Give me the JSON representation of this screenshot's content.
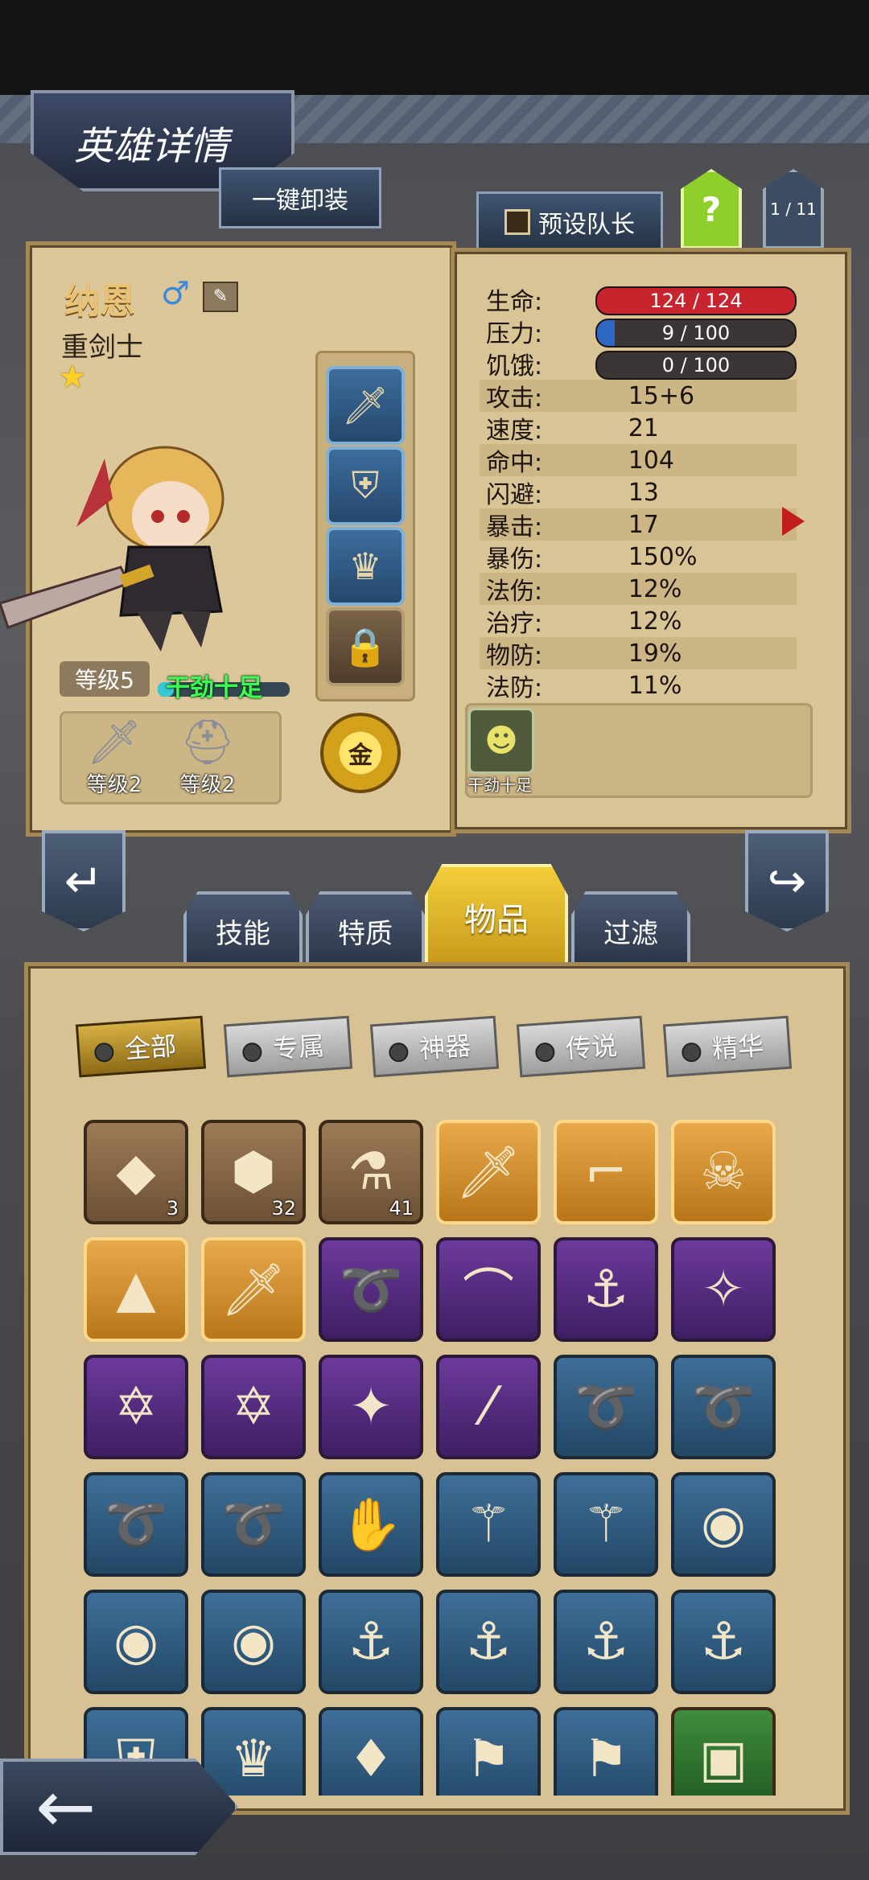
{
  "header": {
    "title": "英雄详情"
  },
  "top_buttons": {
    "unequip_all": "一键卸装",
    "preset_leader": "预设队长",
    "help": "?",
    "page": "1 / 11"
  },
  "hero": {
    "name": "纳恩",
    "class": "重剑士",
    "level": "等级5",
    "status": "干劲十足",
    "equipment_slots": [
      "sword-icon",
      "shield-icon",
      "helmet-icon",
      "lock-icon"
    ],
    "gear": [
      {
        "icon": "sword-icon",
        "label": "等级2"
      },
      {
        "icon": "helmet-icon",
        "label": "等级2"
      }
    ],
    "gold_label": "金"
  },
  "stats": {
    "hp": {
      "label": "生命:",
      "value": "124 / 124",
      "fraction": 1.0,
      "color": "#c8242e"
    },
    "stress": {
      "label": "压力:",
      "value": "9 / 100",
      "fraction": 0.09,
      "color": "#2f67c4"
    },
    "hunger": {
      "label": "饥饿:",
      "value": "0 / 100",
      "fraction": 0.0,
      "color": "#d89a2a"
    },
    "rows": [
      {
        "label": "攻击:",
        "value": "15+6"
      },
      {
        "label": "速度:",
        "value": "21"
      },
      {
        "label": "命中:",
        "value": "104"
      },
      {
        "label": "闪避:",
        "value": "13"
      },
      {
        "label": "暴击:",
        "value": "17"
      },
      {
        "label": "暴伤:",
        "value": "150%"
      },
      {
        "label": "法伤:",
        "value": "12%"
      },
      {
        "label": "治疗:",
        "value": "12%"
      },
      {
        "label": "物防:",
        "value": "19%"
      },
      {
        "label": "法防:",
        "value": "11%"
      }
    ]
  },
  "trait": {
    "label": "干劲十足"
  },
  "tabs": {
    "skills": "技能",
    "traits": "特质",
    "items": "物品",
    "filter": "过滤"
  },
  "filters": {
    "all": "全部",
    "exclusive": "专属",
    "artifact": "神器",
    "legend": "传说",
    "essence": "精华"
  },
  "items": [
    {
      "icon": "fire-gem-icon",
      "rarity": "brown",
      "count": "3"
    },
    {
      "icon": "dark-crystal-icon",
      "rarity": "brown",
      "count": "32"
    },
    {
      "icon": "potion-icon",
      "rarity": "brown",
      "count": "41"
    },
    {
      "icon": "greatsword-icon",
      "rarity": "gold",
      "count": ""
    },
    {
      "icon": "pistol-icon",
      "rarity": "gold",
      "count": ""
    },
    {
      "icon": "skull-staff-icon",
      "rarity": "gold",
      "count": ""
    },
    {
      "icon": "witch-hat-icon",
      "rarity": "gold",
      "count": ""
    },
    {
      "icon": "sword-icon",
      "rarity": "gold",
      "count": ""
    },
    {
      "icon": "whip-icon",
      "rarity": "purple",
      "count": ""
    },
    {
      "icon": "tooth-necklace-icon",
      "rarity": "purple",
      "count": ""
    },
    {
      "icon": "belt-icon",
      "rarity": "purple",
      "count": ""
    },
    {
      "icon": "magic-ring-icon",
      "rarity": "purple",
      "count": ""
    },
    {
      "icon": "amulet-icon",
      "rarity": "purple",
      "count": ""
    },
    {
      "icon": "amulet-icon",
      "rarity": "purple",
      "count": ""
    },
    {
      "icon": "crystal-staff-icon",
      "rarity": "purple",
      "count": ""
    },
    {
      "icon": "spyglass-icon",
      "rarity": "purple",
      "count": ""
    },
    {
      "icon": "whip-icon",
      "rarity": "blue",
      "count": ""
    },
    {
      "icon": "whip-icon",
      "rarity": "blue",
      "count": ""
    },
    {
      "icon": "whip-icon",
      "rarity": "blue",
      "count": ""
    },
    {
      "icon": "whip-icon",
      "rarity": "blue",
      "count": ""
    },
    {
      "icon": "claw-icon",
      "rarity": "blue",
      "count": ""
    },
    {
      "icon": "wand-icon",
      "rarity": "blue",
      "count": ""
    },
    {
      "icon": "wand-icon",
      "rarity": "blue",
      "count": ""
    },
    {
      "icon": "gem-ring-icon",
      "rarity": "blue",
      "count": ""
    },
    {
      "icon": "gem-ring-icon",
      "rarity": "blue",
      "count": ""
    },
    {
      "icon": "gem-ring-icon",
      "rarity": "blue",
      "count": ""
    },
    {
      "icon": "belt-icon",
      "rarity": "blue",
      "count": ""
    },
    {
      "icon": "belt-icon",
      "rarity": "blue",
      "count": ""
    },
    {
      "icon": "belt-icon",
      "rarity": "blue",
      "count": ""
    },
    {
      "icon": "belt-icon",
      "rarity": "blue",
      "count": ""
    },
    {
      "icon": "shield-icon",
      "rarity": "blue",
      "count": ""
    },
    {
      "icon": "helmet-icon",
      "rarity": "blue",
      "count": ""
    },
    {
      "icon": "crystal-icon",
      "rarity": "blue",
      "count": ""
    },
    {
      "icon": "banner-icon",
      "rarity": "blue",
      "count": ""
    },
    {
      "icon": "banner-icon",
      "rarity": "blue",
      "count": ""
    },
    {
      "icon": "backpack-icon",
      "rarity": "green",
      "count": ""
    }
  ]
}
